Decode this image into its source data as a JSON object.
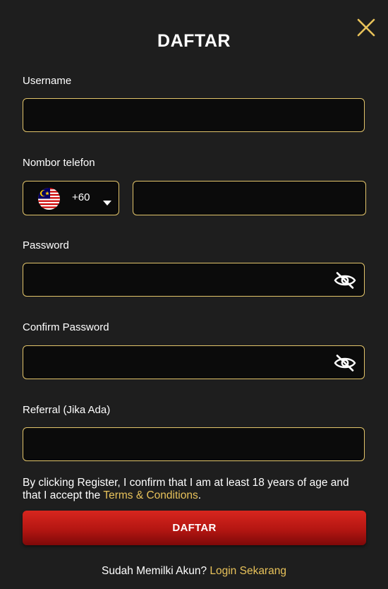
{
  "modal": {
    "title": "DAFTAR",
    "close_icon": "close-icon"
  },
  "form": {
    "username": {
      "label": "Username",
      "value": "",
      "placeholder": ""
    },
    "phone": {
      "label": "Nombor telefon",
      "country_flag": "malaysia-flag-icon",
      "dial_code": "+60",
      "value": "",
      "placeholder": ""
    },
    "password": {
      "label": "Password",
      "value": "",
      "placeholder": "",
      "toggle_icon": "eye-off-icon"
    },
    "confirm_password": {
      "label": "Confirm Password",
      "value": "",
      "placeholder": "",
      "toggle_icon": "eye-off-icon"
    },
    "referral": {
      "label": "Referral (Jika Ada)",
      "value": "",
      "placeholder": ""
    }
  },
  "terms": {
    "text_before": "By clicking Register, I confirm that I am at least 18 years of age and that I accept the ",
    "link_label": "Terms & Conditions",
    "text_after": "."
  },
  "register_button": {
    "label": "DAFTAR"
  },
  "footer": {
    "prompt": "Sudah Memilki Akun? ",
    "login_link": "Login Sekarang"
  },
  "colors": {
    "background": "#1e1e1e",
    "input_background": "#0b0b0b",
    "accent_gold": "#e2c46a",
    "link_gold": "#e8c25a",
    "button_red": "#c41c16"
  }
}
